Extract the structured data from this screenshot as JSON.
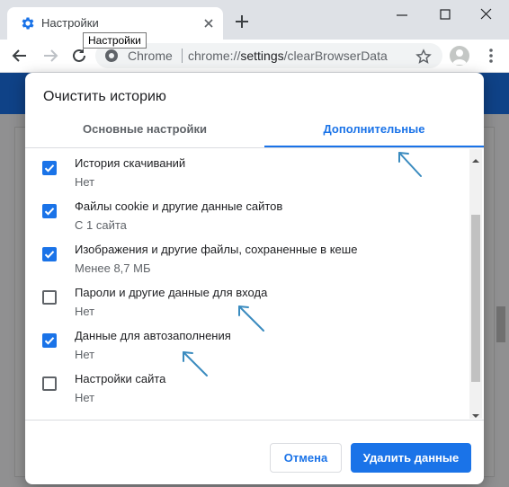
{
  "browser": {
    "tab_title": "Настройки",
    "tooltip": "Настройки",
    "omnibox": {
      "scheme_label": "Chrome",
      "url_prefix": "chrome://",
      "url_host": "settings",
      "url_path": "/clearBrowserData"
    }
  },
  "dialog": {
    "title": "Очистить историю",
    "tabs": [
      {
        "label": "Основные настройки",
        "active": false
      },
      {
        "label": "Дополнительные",
        "active": true
      }
    ],
    "items": [
      {
        "label": "История скачиваний",
        "detail": "Нет",
        "checked": true
      },
      {
        "label": "Файлы cookie и другие данные сайтов",
        "detail": "С 1 сайта",
        "checked": true
      },
      {
        "label": "Изображения и другие файлы, сохраненные в кеше",
        "detail": "Менее 8,7 МБ",
        "checked": true
      },
      {
        "label": "Пароли и другие данные для входа",
        "detail": "Нет",
        "checked": false
      },
      {
        "label": "Данные для автозаполнения",
        "detail": "Нет",
        "checked": true
      },
      {
        "label": "Настройки сайта",
        "detail": "Нет",
        "checked": false
      }
    ],
    "cancel_label": "Отмена",
    "clear_label": "Удалить данные"
  },
  "colors": {
    "accent": "#1a73e8",
    "page_header": "#1a73e8",
    "annotation_arrow": "#3a8bbf"
  }
}
